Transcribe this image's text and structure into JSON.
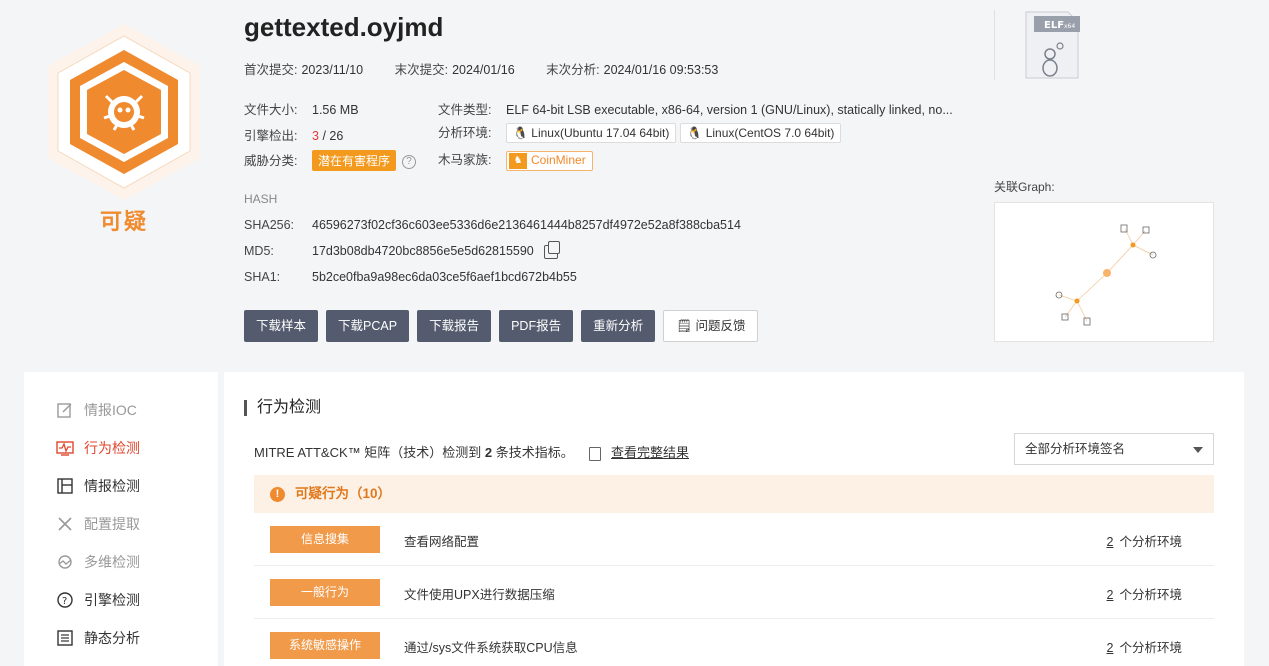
{
  "verdict": "可疑",
  "file_name": "gettexted.oyjmd",
  "dates": {
    "first_submit_label": "首次提交:",
    "first_submit": "2023/11/10",
    "last_submit_label": "末次提交:",
    "last_submit": "2024/01/16",
    "last_analysis_label": "末次分析:",
    "last_analysis": "2024/01/16 09:53:53"
  },
  "info": {
    "size_label": "文件大小:",
    "size": "1.56 MB",
    "type_label": "文件类型:",
    "type": "ELF 64-bit LSB executable, x86-64, version 1 (GNU/Linux), statically linked, no...",
    "engine_label": "引擎检出:",
    "engine_hits": "3",
    "engine_total": "/ 26",
    "env_label": "分析环境:",
    "env1": "Linux(Ubuntu 17.04 64bit)",
    "env2": "Linux(CentOS 7.0 64bit)",
    "threat_label": "威胁分类:",
    "threat": "潜在有害程序",
    "family_label": "木马家族:",
    "family": "CoinMiner"
  },
  "hash": {
    "title": "HASH",
    "sha256_label": "SHA256:",
    "sha256": "46596273f02cf36c603ee5336d6e2136461444b8257df4972e52a8f388cba514",
    "md5_label": "MD5:",
    "md5": "17d3b08db4720bc8856e5e5d62815590",
    "sha1_label": "SHA1:",
    "sha1": "5b2ce0fba9a98ec6da03ce5f6aef1bcd672b4b55"
  },
  "buttons": [
    "下载样本",
    "下载PCAP",
    "下载报告",
    "PDF报告",
    "重新分析"
  ],
  "feedback_button": "问题反馈",
  "elf_badge": "ELF",
  "elf_badge_sub": "x64",
  "graph_label": "关联Graph:",
  "sidebar": [
    "情报IOC",
    "行为检测",
    "情报检测",
    "配置提取",
    "多维检测",
    "引擎检测",
    "静态分析"
  ],
  "section_title": "行为检测",
  "mitre": {
    "prefix": "MITRE ATT&CK™ 矩阵（技术）检测到",
    "count": "2",
    "suffix": "条技术指标。",
    "link": "查看完整结果"
  },
  "env_select": "全部分析环境签名",
  "suspicious_header": "可疑行为（10）",
  "behaviors": [
    {
      "tag": "信息搜集",
      "desc": "查看网络配置",
      "env_count": "2",
      "env_text": "个分析环境"
    },
    {
      "tag": "一般行为",
      "desc": "文件使用UPX进行数据压缩",
      "env_count": "2",
      "env_text": "个分析环境"
    },
    {
      "tag": "系统敏感操作",
      "desc": "通过/sys文件系统获取CPU信息",
      "env_count": "2",
      "env_text": "个分析环境"
    }
  ],
  "colors": {
    "accent": "#f08a2e",
    "active_red": "#e0462d",
    "btn_dark": "#555b6e"
  }
}
